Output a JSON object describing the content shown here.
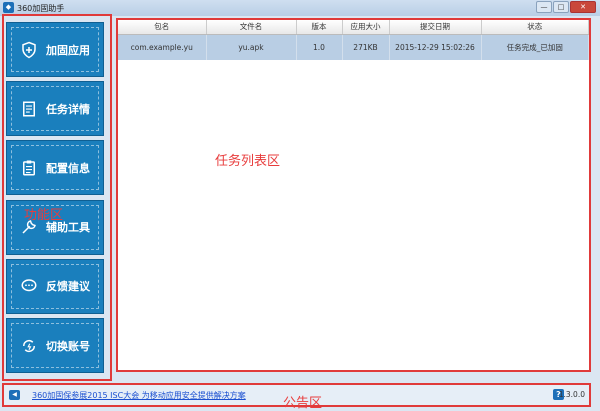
{
  "window": {
    "title": "360加固助手",
    "minimize": "—",
    "maximize": "□",
    "close": "✕"
  },
  "sidebar": {
    "items": [
      {
        "label": "加固应用",
        "icon": "shield-plus-icon"
      },
      {
        "label": "任务详情",
        "icon": "task-list-icon"
      },
      {
        "label": "配置信息",
        "icon": "clipboard-icon"
      },
      {
        "label": "辅助工具",
        "icon": "wrench-icon"
      },
      {
        "label": "反馈建议",
        "icon": "chat-icon"
      },
      {
        "label": "切换账号",
        "icon": "switch-icon"
      }
    ]
  },
  "table": {
    "headers": [
      "包名",
      "文件名",
      "版本",
      "应用大小",
      "提交日期",
      "状态"
    ],
    "rows": [
      [
        "com.example.yu",
        "yu.apk",
        "1.0",
        "271KB",
        "2015-12-29 15:02:26",
        "任务完成_已加固"
      ]
    ]
  },
  "annotations": {
    "function_area": "功能区",
    "task_area": "任务列表区",
    "notice_area": "公告区"
  },
  "footer": {
    "notice": "360加固保参展2015 ISC大会 为移动应用安全提供解决方案",
    "help": "?",
    "version": "1.3.0.0"
  }
}
